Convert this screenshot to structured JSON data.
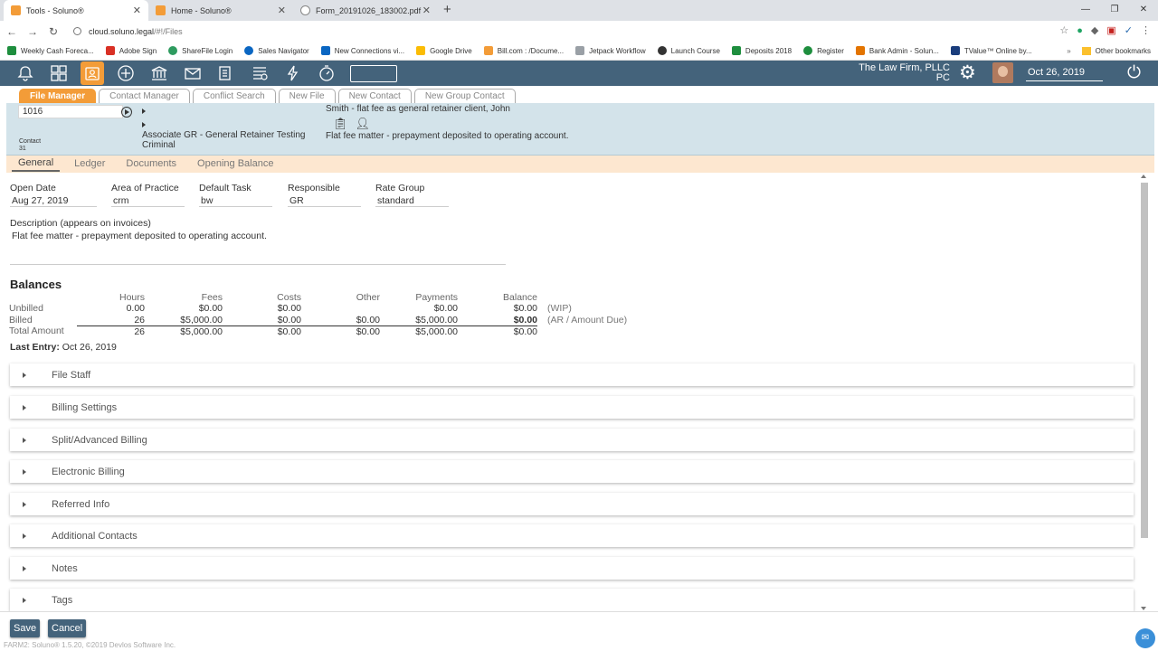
{
  "browser": {
    "tabs": [
      {
        "title": "Tools - Soluno®",
        "color": "#f39c38"
      },
      {
        "title": "Home - Soluno®",
        "color": "#f39c38"
      },
      {
        "title": "Form_20191026_183002.pdf",
        "color": "#888888"
      }
    ],
    "url_host": "cloud.soluno.legal",
    "url_path": "/#!/Files",
    "bookmarks": [
      {
        "label": "Weekly Cash Foreca...",
        "color": "#1e8e3e"
      },
      {
        "label": "Adobe Sign",
        "color": "#d93025"
      },
      {
        "label": "ShareFile Login",
        "color": "#2e9b5f"
      },
      {
        "label": "Sales Navigator",
        "color": "#0a66c2"
      },
      {
        "label": "New Connections vi...",
        "color": "#0a66c2"
      },
      {
        "label": "Google Drive",
        "color": "#fbbc04"
      },
      {
        "label": "Bill.com : /Docume...",
        "color": "#f39c38"
      },
      {
        "label": "Jetpack Workflow",
        "color": "#9aa0a6"
      },
      {
        "label": "Launch Course",
        "color": "#333333"
      },
      {
        "label": "Deposits 2018",
        "color": "#1e8e3e"
      },
      {
        "label": "Register",
        "color": "#1e8e3e"
      },
      {
        "label": "Bank Admin - Solun...",
        "color": "#e37400"
      },
      {
        "label": "TValue™ Online by...",
        "color": "#1a3d7c"
      }
    ],
    "other_bookmarks": "Other bookmarks"
  },
  "app": {
    "firm_name_line1": "The Law Firm, PLLC",
    "firm_name_line2": "PC",
    "date": "Oct 26, 2019",
    "accent": "#f39c38",
    "bar_color": "#44637b"
  },
  "subtabs": [
    "File Manager",
    "Contact Manager",
    "Conflict Search",
    "New File",
    "New Contact",
    "New Group Contact"
  ],
  "file": {
    "number": "1016",
    "contact_label": "Contact",
    "contact_id": "31",
    "associate": "Associate GR - General Retainer Testing",
    "area": "Criminal",
    "client": "Smith - flat fee as general retainer client, John",
    "description": "Flat fee matter - prepayment deposited to operating account."
  },
  "section_tabs": [
    "General",
    "Ledger",
    "Documents",
    "Opening Balance"
  ],
  "general": {
    "open_date_label": "Open Date",
    "open_date": "Aug 27, 2019",
    "area_label": "Area of Practice",
    "area": "crm",
    "task_label": "Default Task",
    "task": "bw",
    "responsible_label": "Responsible",
    "responsible": "GR",
    "rate_label": "Rate Group",
    "rate": "standard",
    "desc_label": "Description (appears on invoices)",
    "desc": "Flat fee matter - prepayment deposited to operating account."
  },
  "balances": {
    "title": "Balances",
    "columns": [
      "Hours",
      "Fees",
      "Costs",
      "Other",
      "Payments",
      "Balance"
    ],
    "rows": [
      {
        "label": "Unbilled",
        "values": [
          "0.00",
          "$0.00",
          "$0.00",
          "",
          "$0.00",
          "$0.00"
        ],
        "note": "(WIP)"
      },
      {
        "label": "Billed",
        "values": [
          "26",
          "$5,000.00",
          "$0.00",
          "$0.00",
          "$5,000.00",
          "$0.00"
        ],
        "note": "(AR / Amount Due)"
      },
      {
        "label": "Total Amount",
        "values": [
          "26",
          "$5,000.00",
          "$0.00",
          "$0.00",
          "$5,000.00",
          "$0.00"
        ],
        "note": ""
      }
    ],
    "last_entry_label": "Last Entry:",
    "last_entry": "Oct 26, 2019"
  },
  "accordions": [
    "File Staff",
    "Billing Settings",
    "Split/Advanced Billing",
    "Electronic Billing",
    "Referred Info",
    "Additional Contacts",
    "Notes",
    "Tags"
  ],
  "footer": {
    "save": "Save",
    "cancel": "Cancel",
    "copyright": "FARM2: Soluno® 1.5.20, ©2019 Devlos Software Inc."
  }
}
